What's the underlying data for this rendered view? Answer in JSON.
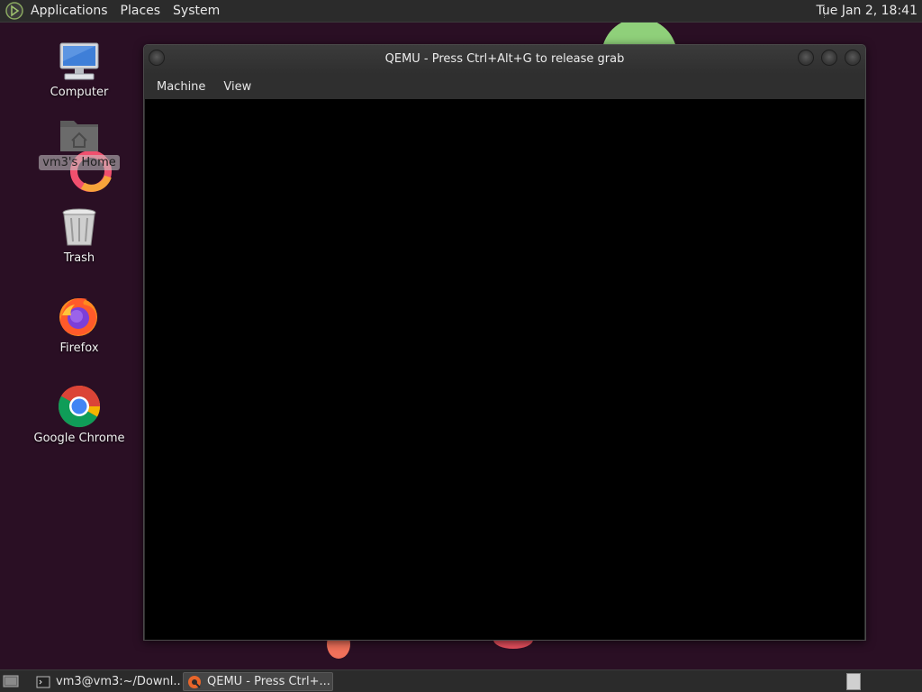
{
  "top_panel": {
    "menus": [
      "Applications",
      "Places",
      "System"
    ],
    "clock": "Tue Jan  2, 18:41"
  },
  "desktop": {
    "icons": [
      {
        "label": "Computer",
        "icon": "computer-icon"
      },
      {
        "label": "vm3's Home",
        "icon": "home-folder-icon",
        "selected": true
      },
      {
        "label": "Trash",
        "icon": "trash-icon"
      },
      {
        "label": "Firefox",
        "icon": "firefox-icon"
      },
      {
        "label": "Google Chrome",
        "icon": "chrome-icon"
      }
    ]
  },
  "qemu_window": {
    "title": "QEMU - Press Ctrl+Alt+G to release grab",
    "menus": [
      "Machine",
      "View"
    ]
  },
  "taskbar": {
    "tasks": [
      {
        "label": "vm3@vm3:~/Downl...",
        "icon": "terminal-icon"
      },
      {
        "label": "QEMU - Press Ctrl+...",
        "icon": "qemu-icon",
        "active": true
      }
    ]
  },
  "colors": {
    "panel_bg": "#2b2b2b",
    "wallpaper": "#2a0f24",
    "vm_screen": "#000000"
  }
}
